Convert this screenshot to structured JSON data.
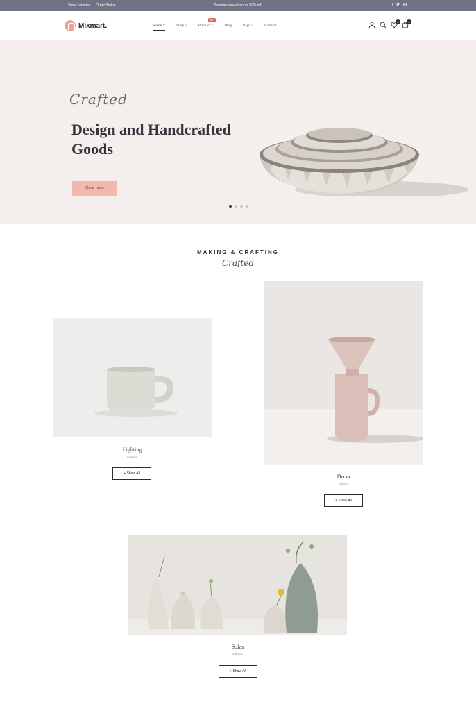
{
  "topbar": {
    "links": [
      "Store Location",
      "Order Status"
    ],
    "promo": "Summer sale discount 50% off.",
    "social_icons": [
      "facebook-icon",
      "twitter-icon",
      "instagram-icon"
    ]
  },
  "header": {
    "brand": "Mixmart.",
    "nav": [
      {
        "label": "Home",
        "caret": true,
        "active": true
      },
      {
        "label": "Shop",
        "caret": true
      },
      {
        "label": "Product",
        "caret": true,
        "badge": "HOT"
      },
      {
        "label": "Blog",
        "caret": false
      },
      {
        "label": "Page",
        "caret": true
      },
      {
        "label": "Contact",
        "caret": false
      }
    ],
    "wishlist_count": "0",
    "cart_count": "0",
    "icons": [
      "user-icon",
      "search-icon",
      "heart-icon",
      "cart-icon"
    ]
  },
  "hero": {
    "script": "Crafted",
    "title": "Design and Handcrafted Goods",
    "cta": "Show more",
    "slides": 4,
    "active_slide": 1,
    "background": "#f4efec",
    "cta_color": "#f1b9ad"
  },
  "section": {
    "title": "MAKING & CRAFTING",
    "script": "Crafted"
  },
  "categories": [
    {
      "name": "Lighting",
      "count": "0 items",
      "button": "+ Show All"
    },
    {
      "name": "Decor",
      "count": "0 items",
      "button": "+ Show All"
    },
    {
      "name": "Sofas",
      "count": "6 items",
      "button": "+ Show All"
    }
  ]
}
